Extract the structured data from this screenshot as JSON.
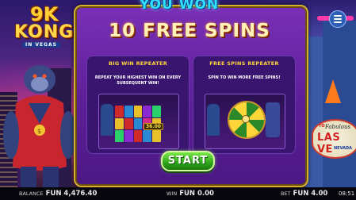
{
  "header": {
    "logo_top": "9K",
    "logo_main": "KONG",
    "logo_sub": "IN VEGAS"
  },
  "banner": {
    "you_won": "YOU WON",
    "free_spins": "10 FREE SPINS"
  },
  "cards": [
    {
      "title": "BIG WIN REPEATER",
      "description": "REPEAT YOUR HIGHEST WIN ON EVERY SUBSEQUENT WIN!",
      "preview_amount": "36.00"
    },
    {
      "title": "FREE SPINS REPEATER",
      "description": "SPIN TO WIN MORE FREE SPINS!"
    }
  ],
  "start_label": "START",
  "sign": {
    "to": "TO",
    "fabulous": "Fabulous",
    "las": "LAS VE",
    "nevada": "NEVADA"
  },
  "status": {
    "balance_label": "BALANCE",
    "balance_value": "FUN 4,476.40",
    "win_label": "WIN",
    "win_value": "FUN 0.00",
    "bet_label": "BET",
    "bet_value": "FUN 4.00",
    "time": "08:51"
  },
  "colors": {
    "panel": "#6a27a8",
    "accent_gold": "#d4b12e",
    "you_won_cyan": "#2fe0ff",
    "start_green": "#2ea51a"
  },
  "icons": {
    "menu": "hamburger-menu-icon"
  }
}
